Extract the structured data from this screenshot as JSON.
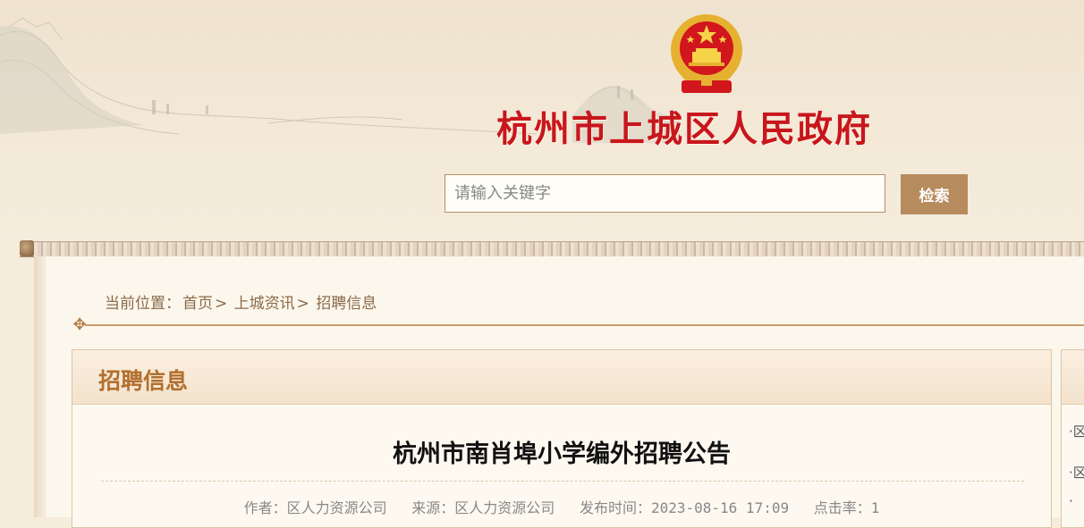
{
  "header": {
    "site_title": "杭州市上城区人民政府",
    "search_placeholder": "请输入关键字",
    "search_button_label": "检索"
  },
  "breadcrumb": {
    "prefix": "当前位置：",
    "items": [
      "首页",
      "上城资讯",
      "招聘信息"
    ],
    "separator": ">"
  },
  "panel": {
    "title": "招聘信息"
  },
  "article": {
    "title": "杭州市南肖埠小学编外招聘公告",
    "author_label": "作者：",
    "author": "区人力资源公司",
    "source_label": "来源：",
    "source": "区人力资源公司",
    "published_label": "发布时间：",
    "published": "2023-08-16 17:09",
    "clicks_label": "点击率：",
    "clicks": "1"
  },
  "side_panel": {
    "items": [
      "·区",
      "·区",
      "·"
    ]
  },
  "colors": {
    "title_red": "#c8161d",
    "accent_brown": "#b68c5e",
    "panel_title": "#b26f2d"
  }
}
